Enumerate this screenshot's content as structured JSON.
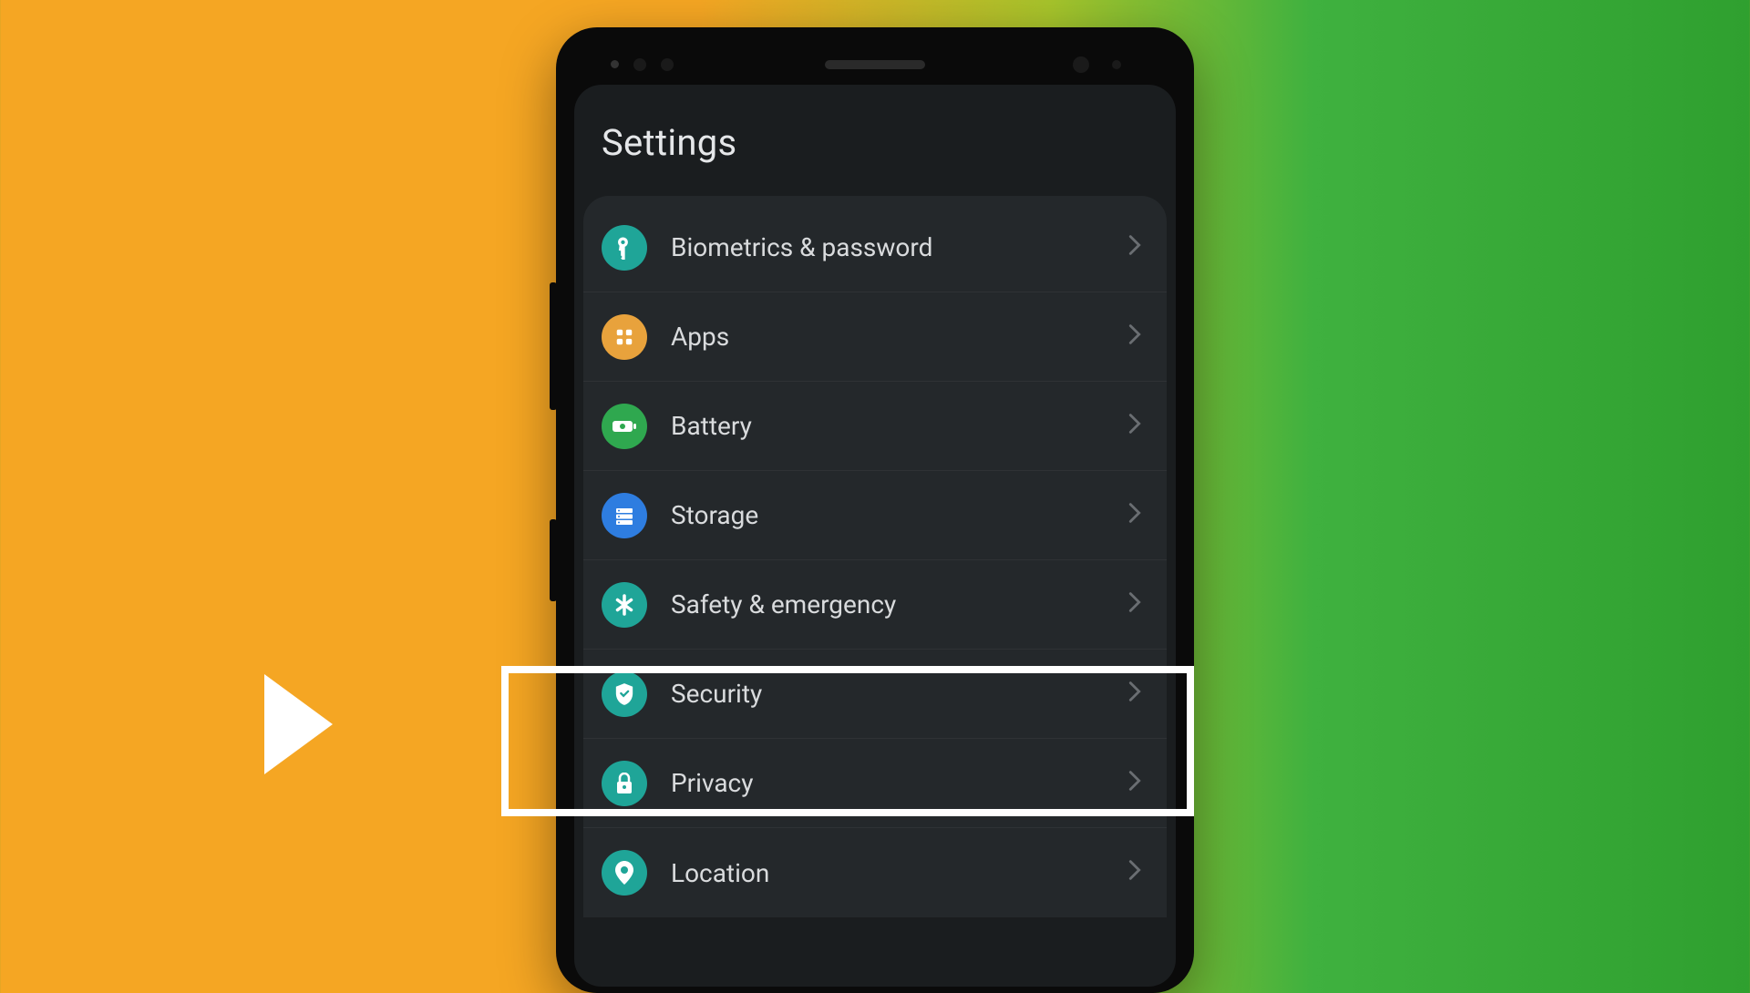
{
  "header": {
    "title": "Settings"
  },
  "items": [
    {
      "label": "Biometrics & password",
      "icon": "key",
      "color": "#1fa598"
    },
    {
      "label": "Apps",
      "icon": "grid",
      "color": "#e8a23c"
    },
    {
      "label": "Battery",
      "icon": "battery",
      "color": "#2fa84f"
    },
    {
      "label": "Storage",
      "icon": "storage",
      "color": "#2e7de0"
    },
    {
      "label": "Safety & emergency",
      "icon": "asterisk",
      "color": "#1fa598"
    },
    {
      "label": "Security",
      "icon": "shield",
      "color": "#1fa598"
    },
    {
      "label": "Privacy",
      "icon": "lock",
      "color": "#1fa598"
    },
    {
      "label": "Location",
      "icon": "pin",
      "color": "#1fa598"
    }
  ],
  "highlighted_item": "Security"
}
